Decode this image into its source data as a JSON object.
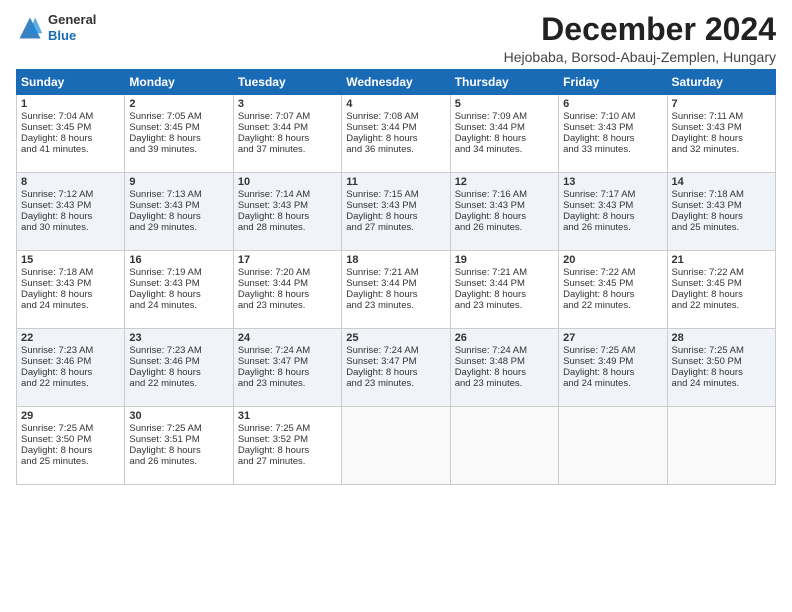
{
  "header": {
    "logo_general": "General",
    "logo_blue": "Blue",
    "title": "December 2024",
    "subtitle": "Hejobaba, Borsod-Abauj-Zemplen, Hungary"
  },
  "columns": [
    "Sunday",
    "Monday",
    "Tuesday",
    "Wednesday",
    "Thursday",
    "Friday",
    "Saturday"
  ],
  "weeks": [
    [
      {
        "day": "1",
        "sr": "7:04 AM",
        "ss": "3:45 PM",
        "dl": "8 hours and 41 minutes."
      },
      {
        "day": "2",
        "sr": "7:05 AM",
        "ss": "3:45 PM",
        "dl": "8 hours and 39 minutes."
      },
      {
        "day": "3",
        "sr": "7:07 AM",
        "ss": "3:44 PM",
        "dl": "8 hours and 37 minutes."
      },
      {
        "day": "4",
        "sr": "7:08 AM",
        "ss": "3:44 PM",
        "dl": "8 hours and 36 minutes."
      },
      {
        "day": "5",
        "sr": "7:09 AM",
        "ss": "3:44 PM",
        "dl": "8 hours and 34 minutes."
      },
      {
        "day": "6",
        "sr": "7:10 AM",
        "ss": "3:43 PM",
        "dl": "8 hours and 33 minutes."
      },
      {
        "day": "7",
        "sr": "7:11 AM",
        "ss": "3:43 PM",
        "dl": "8 hours and 32 minutes."
      }
    ],
    [
      {
        "day": "8",
        "sr": "7:12 AM",
        "ss": "3:43 PM",
        "dl": "8 hours and 30 minutes."
      },
      {
        "day": "9",
        "sr": "7:13 AM",
        "ss": "3:43 PM",
        "dl": "8 hours and 29 minutes."
      },
      {
        "day": "10",
        "sr": "7:14 AM",
        "ss": "3:43 PM",
        "dl": "8 hours and 28 minutes."
      },
      {
        "day": "11",
        "sr": "7:15 AM",
        "ss": "3:43 PM",
        "dl": "8 hours and 27 minutes."
      },
      {
        "day": "12",
        "sr": "7:16 AM",
        "ss": "3:43 PM",
        "dl": "8 hours and 26 minutes."
      },
      {
        "day": "13",
        "sr": "7:17 AM",
        "ss": "3:43 PM",
        "dl": "8 hours and 26 minutes."
      },
      {
        "day": "14",
        "sr": "7:18 AM",
        "ss": "3:43 PM",
        "dl": "8 hours and 25 minutes."
      }
    ],
    [
      {
        "day": "15",
        "sr": "7:18 AM",
        "ss": "3:43 PM",
        "dl": "8 hours and 24 minutes."
      },
      {
        "day": "16",
        "sr": "7:19 AM",
        "ss": "3:43 PM",
        "dl": "8 hours and 24 minutes."
      },
      {
        "day": "17",
        "sr": "7:20 AM",
        "ss": "3:44 PM",
        "dl": "8 hours and 23 minutes."
      },
      {
        "day": "18",
        "sr": "7:21 AM",
        "ss": "3:44 PM",
        "dl": "8 hours and 23 minutes."
      },
      {
        "day": "19",
        "sr": "7:21 AM",
        "ss": "3:44 PM",
        "dl": "8 hours and 23 minutes."
      },
      {
        "day": "20",
        "sr": "7:22 AM",
        "ss": "3:45 PM",
        "dl": "8 hours and 22 minutes."
      },
      {
        "day": "21",
        "sr": "7:22 AM",
        "ss": "3:45 PM",
        "dl": "8 hours and 22 minutes."
      }
    ],
    [
      {
        "day": "22",
        "sr": "7:23 AM",
        "ss": "3:46 PM",
        "dl": "8 hours and 22 minutes."
      },
      {
        "day": "23",
        "sr": "7:23 AM",
        "ss": "3:46 PM",
        "dl": "8 hours and 22 minutes."
      },
      {
        "day": "24",
        "sr": "7:24 AM",
        "ss": "3:47 PM",
        "dl": "8 hours and 23 minutes."
      },
      {
        "day": "25",
        "sr": "7:24 AM",
        "ss": "3:47 PM",
        "dl": "8 hours and 23 minutes."
      },
      {
        "day": "26",
        "sr": "7:24 AM",
        "ss": "3:48 PM",
        "dl": "8 hours and 23 minutes."
      },
      {
        "day": "27",
        "sr": "7:25 AM",
        "ss": "3:49 PM",
        "dl": "8 hours and 24 minutes."
      },
      {
        "day": "28",
        "sr": "7:25 AM",
        "ss": "3:50 PM",
        "dl": "8 hours and 24 minutes."
      }
    ],
    [
      {
        "day": "29",
        "sr": "7:25 AM",
        "ss": "3:50 PM",
        "dl": "8 hours and 25 minutes."
      },
      {
        "day": "30",
        "sr": "7:25 AM",
        "ss": "3:51 PM",
        "dl": "8 hours and 26 minutes."
      },
      {
        "day": "31",
        "sr": "7:25 AM",
        "ss": "3:52 PM",
        "dl": "8 hours and 27 minutes."
      },
      null,
      null,
      null,
      null
    ]
  ],
  "labels": {
    "sunrise": "Sunrise:",
    "sunset": "Sunset:",
    "daylight": "Daylight: 8 hours"
  }
}
